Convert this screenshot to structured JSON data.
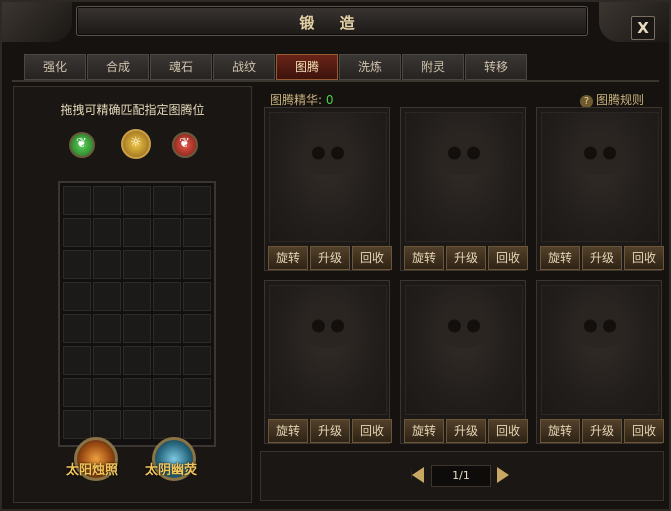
{
  "window": {
    "title": "锻 造",
    "close_label": "X"
  },
  "tabs": [
    {
      "label": "强化",
      "active": false
    },
    {
      "label": "合成",
      "active": false
    },
    {
      "label": "魂石",
      "active": false
    },
    {
      "label": "战纹",
      "active": false
    },
    {
      "label": "图腾",
      "active": true
    },
    {
      "label": "洗炼",
      "active": false
    },
    {
      "label": "附灵",
      "active": false
    },
    {
      "label": "转移",
      "active": false
    }
  ],
  "left_panel": {
    "hint": "拖拽可精确匹配指定图腾位",
    "bottom_buttons": [
      {
        "label": "太阳烛照"
      },
      {
        "label": "太阴幽荧"
      }
    ]
  },
  "essence": {
    "label": "图腾精华:",
    "value": "0"
  },
  "rules_link": {
    "icon": "?",
    "label": "图腾规则"
  },
  "slots": [
    {
      "rotate": "旋转",
      "upgrade": "升级",
      "recycle": "回收"
    },
    {
      "rotate": "旋转",
      "upgrade": "升级",
      "recycle": "回收"
    },
    {
      "rotate": "旋转",
      "upgrade": "升级",
      "recycle": "回收"
    },
    {
      "rotate": "旋转",
      "upgrade": "升级",
      "recycle": "回收"
    },
    {
      "rotate": "旋转",
      "upgrade": "升级",
      "recycle": "回收"
    },
    {
      "rotate": "旋转",
      "upgrade": "升级",
      "recycle": "回收"
    }
  ],
  "pager": {
    "text": "1/1"
  },
  "colors": {
    "accent_tab": "#6a2418",
    "gold": "#f1c55a",
    "green_value": "#4fd24a"
  }
}
